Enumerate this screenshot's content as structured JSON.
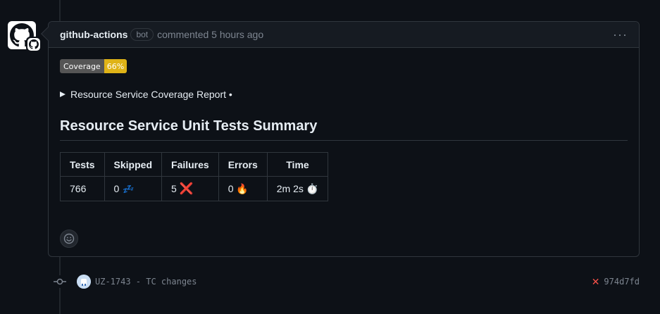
{
  "comment": {
    "author": "github-actions",
    "bot_label": "bot",
    "meta": "commented 5 hours ago",
    "menu_glyph": "···"
  },
  "badge": {
    "label": "Coverage",
    "value": "66%",
    "value_color": "#dfb317"
  },
  "details": {
    "summary": "Resource Service Coverage Report •"
  },
  "summary_title": "Resource Service Unit Tests Summary",
  "table": {
    "headers": [
      "Tests",
      "Skipped",
      "Failures",
      "Errors",
      "Time"
    ],
    "row": {
      "tests": "766",
      "skipped": "0",
      "skipped_emoji": "💤",
      "failures": "5",
      "failures_emoji": "❌",
      "errors": "0",
      "errors_emoji": "🔥",
      "time": "2m 2s",
      "time_emoji": "⏱️"
    }
  },
  "commit": {
    "message": "UZ-1743 - TC changes",
    "status_glyph": "✕",
    "sha": "974d7fd"
  },
  "colors": {
    "background": "#0d1117",
    "border": "#30363d",
    "muted": "#7d8590",
    "danger": "#f85149"
  },
  "icons": {
    "avatar": "github-mark-icon",
    "avatar_badge": "github-app-icon",
    "reaction": "smiley-icon",
    "commit_node": "git-commit-icon",
    "status": "x-icon"
  }
}
